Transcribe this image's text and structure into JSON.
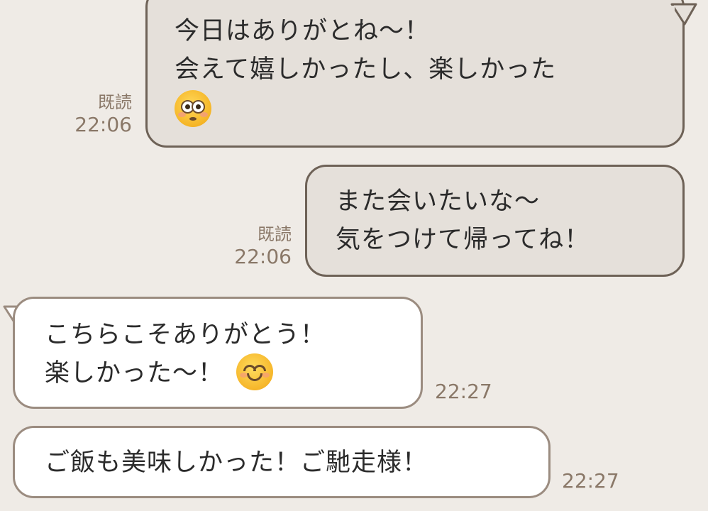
{
  "messages": [
    {
      "id": "m1",
      "direction": "sent",
      "lines": [
        "今日はありがとね～！",
        "会えて嬉しかったし、楽しかった"
      ],
      "emoji": "flushed-face-icon",
      "read_label": "既読",
      "time": "22:06"
    },
    {
      "id": "m2",
      "direction": "sent",
      "lines": [
        "また会いたいな～",
        "気をつけて帰ってね！"
      ],
      "read_label": "既読",
      "time": "22:06"
    },
    {
      "id": "m3",
      "direction": "received",
      "lines": [
        "こちらこそありがとう！",
        "楽しかった〜！"
      ],
      "emoji": "smiling-face-icon",
      "time": "22:27"
    },
    {
      "id": "m4",
      "direction": "received",
      "lines": [
        "ご飯も美味しかった！ご馳走様！"
      ],
      "time": "22:27"
    }
  ],
  "colors": {
    "background": "#efebe6",
    "sent_bubble": "#e5e0da",
    "received_bubble": "#ffffff",
    "border": "#6e6257",
    "meta_text": "#8a7868"
  }
}
